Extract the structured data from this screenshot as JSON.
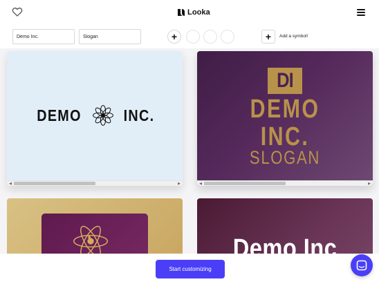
{
  "header": {
    "brand": "Looka",
    "favorites_icon": "heart-icon",
    "menu_icon": "hamburger-menu-icon"
  },
  "toolbar": {
    "company_name_value": "Demo Inc.",
    "slogan_value": "Slogan",
    "add_color_icon": "plus-icon",
    "add_symbol_icon": "plus-icon",
    "add_symbol_label": "Add a symbol!"
  },
  "logos": [
    {
      "lines": [
        "DEMO",
        "INC."
      ],
      "symbol": "flower-icon",
      "background": "#e2eef7"
    },
    {
      "monogram": "DI",
      "lines": [
        "DEMO",
        "INC.",
        "SLOGAN"
      ],
      "background": "#55295b",
      "accent": "#b8924a"
    },
    {
      "symbol": "atom-icon",
      "background": "#d8c184"
    },
    {
      "lines": [
        "Demo Inc"
      ],
      "background": "#6a3557"
    }
  ],
  "footer": {
    "cta_label": "Start customizing",
    "chat_icon": "chat-icon"
  },
  "colors": {
    "accent": "#4a3ff6",
    "gold": "#b8924a"
  }
}
